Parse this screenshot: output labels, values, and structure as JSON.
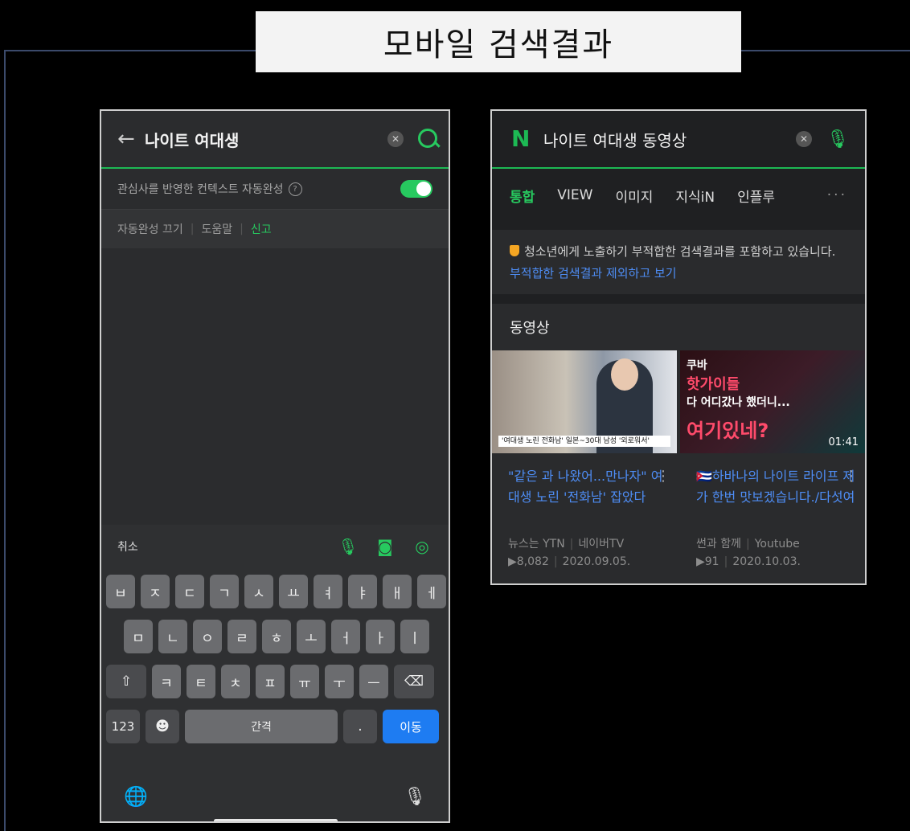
{
  "slide_title": "모바일 검색결과",
  "left_phone": {
    "back_glyph": "←",
    "query": "나이트 여대생",
    "context_label": "관심사를 반영한 컨텍스트 자동완성",
    "help_glyph": "?",
    "links": [
      "자동완성 끄기",
      "도움말",
      "신고"
    ],
    "keyboard": {
      "cancel": "취소",
      "row1": [
        "ㅂ",
        "ㅈ",
        "ㄷ",
        "ㄱ",
        "ㅅ",
        "ㅛ",
        "ㅕ",
        "ㅑ",
        "ㅐ",
        "ㅔ"
      ],
      "row2": [
        "ㅁ",
        "ㄴ",
        "ㅇ",
        "ㄹ",
        "ㅎ",
        "ㅗ",
        "ㅓ",
        "ㅏ",
        "ㅣ"
      ],
      "row3": [
        "ㅋ",
        "ㅌ",
        "ㅊ",
        "ㅍ",
        "ㅠ",
        "ㅜ",
        "ㅡ"
      ],
      "shift": "⇧",
      "backspace": "⌫",
      "num": "123",
      "emoji": "☻",
      "space": "간격",
      "period": ".",
      "go": "이동"
    }
  },
  "right_phone": {
    "logo": "N",
    "query": "나이트 여대생 동영상",
    "tabs": [
      "통합",
      "VIEW",
      "이미지",
      "지식iN",
      "인플루"
    ],
    "more": "···",
    "notice_text": "청소년에게 노출하기 부적합한 검색결과를 포함하고 있습니다.",
    "notice_link": "부적합한 검색결과 제외하고 보기",
    "section_title": "동영상",
    "videos": [
      {
        "thumb_caption": "'여대생 노린 전화남' 일본~30대 남성 '외로워서'",
        "title": "\"같은 과 나왔어...만나자\" 여대생 노린 '전화남' 잡았다",
        "source": "뉴스는 YTN",
        "channel": "네이버TV",
        "views": "▶8,082",
        "date": "2020.09.05."
      },
      {
        "thumb_lines": [
          "쿠바",
          "핫가이들",
          "다 어디갔나 했더니...",
          "여기있네?"
        ],
        "duration": "01:41",
        "title": "🇨🇺하바나의 나이트 라이프 제가 한번 맛보겠습니다./다섯여",
        "source": "썬과 함께",
        "channel": "Youtube",
        "views": "▶91",
        "date": "2020.10.03."
      }
    ]
  }
}
